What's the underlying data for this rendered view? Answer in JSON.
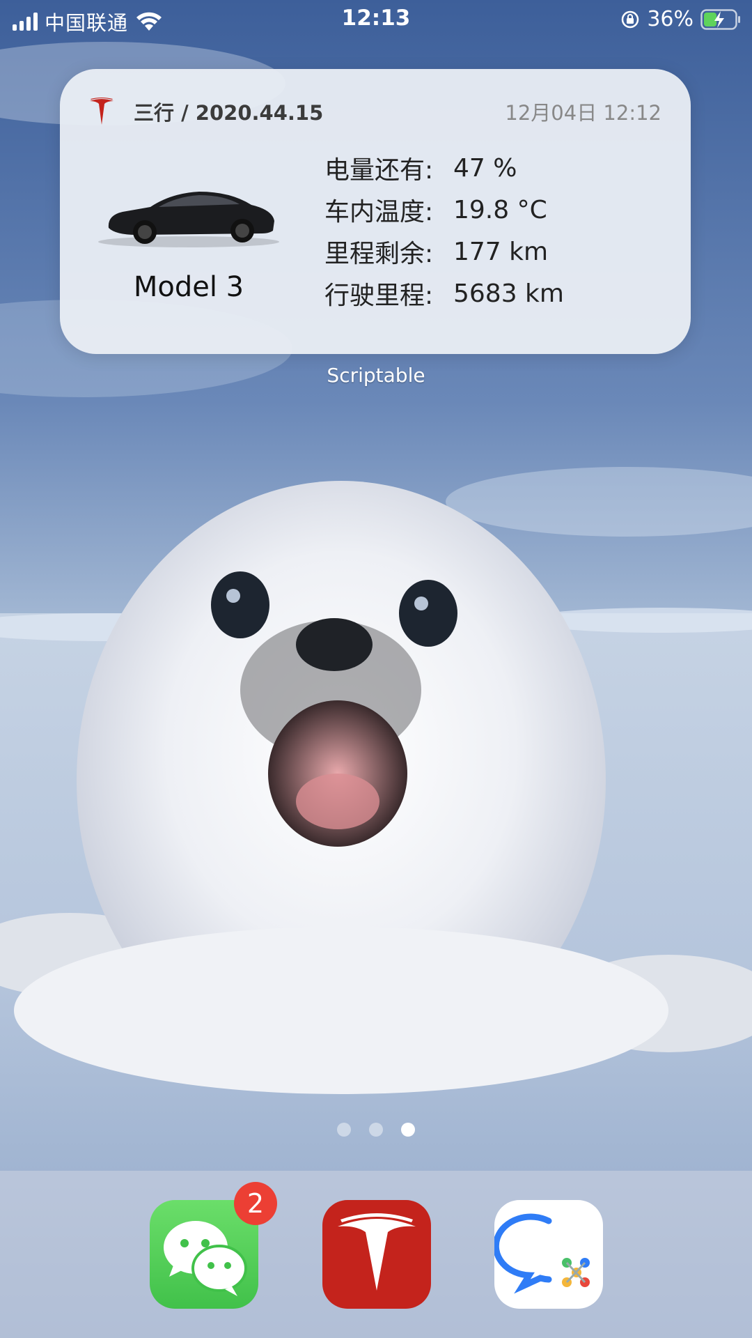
{
  "status_bar": {
    "carrier": "中国联通",
    "time": "12:13",
    "battery_percent": "36%",
    "icons": [
      "signal-icon",
      "wifi-icon",
      "rotation-lock-icon",
      "battery-charging-icon"
    ]
  },
  "widget": {
    "title": "三行 / 2020.44.15",
    "timestamp": "12月04日 12:12",
    "model": "Model 3",
    "stats": [
      {
        "label": "电量还有:",
        "value": "47 %"
      },
      {
        "label": "车内温度:",
        "value": "19.8 °C"
      },
      {
        "label": "里程剩余:",
        "value": "177 km"
      },
      {
        "label": "行驶里程:",
        "value": "5683 km"
      }
    ],
    "app_label": "Scriptable"
  },
  "page_dots": {
    "count": 3,
    "active_index": 2
  },
  "dock": {
    "apps": [
      {
        "name": "WeChat",
        "icon": "wechat-icon",
        "badge": "2"
      },
      {
        "name": "Tesla",
        "icon": "tesla-icon"
      },
      {
        "name": "Chat",
        "icon": "chat-bubble-icon"
      }
    ]
  },
  "colors": {
    "tesla_red": "#c4231c",
    "wechat_green": "#4cc954",
    "badge_red": "#ec3f34"
  }
}
